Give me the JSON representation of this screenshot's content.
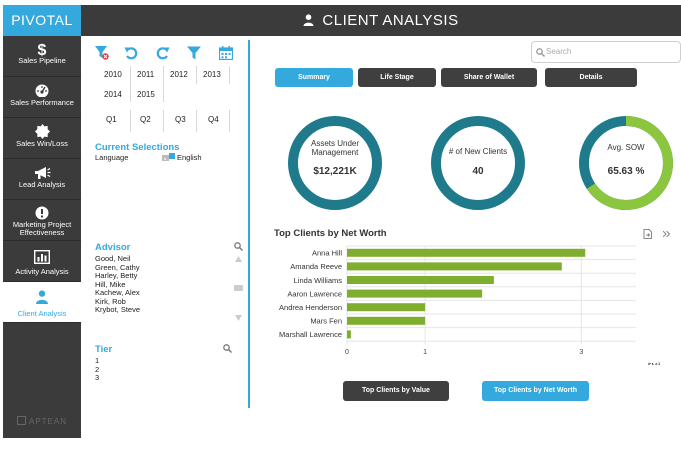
{
  "brand": "PIVOTAL",
  "header": {
    "title": "CLIENT ANALYSIS"
  },
  "sidebar": {
    "items": [
      {
        "label": "Sales Pipeline",
        "icon": "dollar-icon"
      },
      {
        "label": "Sales Performance",
        "icon": "gauge-icon"
      },
      {
        "label": "Sales Win/Loss",
        "icon": "badge-icon"
      },
      {
        "label": "Lead Analysis",
        "icon": "megaphone-icon"
      },
      {
        "label": "Marketing Project Effectiveness",
        "icon": "alert-icon"
      },
      {
        "label": "Activity Analysis",
        "icon": "bar-chart-icon"
      },
      {
        "label": "Client Analysis",
        "icon": "user-icon"
      }
    ],
    "footer": "APTEAN"
  },
  "filters": {
    "years": [
      "2010",
      "2011",
      "2012",
      "2013",
      "2014",
      "2015"
    ],
    "quarters": [
      "Q1",
      "Q2",
      "Q3",
      "Q4"
    ],
    "current_selections": {
      "title": "Current Selections",
      "field": "Language",
      "value": "English"
    },
    "advisor": {
      "title": "Advisor",
      "names": [
        "Good, Neil",
        "Green, Cathy",
        "Harley, Betty",
        "Hill, Mike",
        "Kachew, Alex",
        "Kirk, Rob",
        "Krybot, Steve"
      ]
    },
    "tier": {
      "title": "Tier",
      "values": [
        "1",
        "2",
        "3"
      ]
    }
  },
  "search": {
    "placeholder": "Search"
  },
  "tabs": [
    "Summary",
    "Life Stage",
    "Share of Wallet",
    "Details"
  ],
  "gauges": [
    {
      "label_line1": "Assets Under",
      "label_line2": "Management",
      "value": "$12,221K",
      "fraction": 1.0
    },
    {
      "label_line1": "# of New Clients",
      "label_line2": "",
      "value": "40",
      "fraction": 1.0
    },
    {
      "label_line1": "Avg. SOW",
      "label_line2": "",
      "value": "65.63 %",
      "fraction": 0.6563
    }
  ],
  "chart_data": {
    "type": "bar",
    "orientation": "horizontal",
    "title": "Top Clients by Net Worth",
    "categories": [
      "Anna Hill",
      "Amanda Reeve",
      "Linda Williams",
      "Aaron Lawrence",
      "Andrea Henderson",
      "Mars Fen",
      "Marshall Lawrence"
    ],
    "values": [
      3.05,
      2.75,
      1.88,
      1.73,
      1.0,
      1.0,
      0.05
    ],
    "xticks": [
      "0",
      "1",
      "3"
    ],
    "xtick_values": [
      0,
      1,
      3
    ],
    "xlim": [
      0,
      3.7
    ],
    "unit_label": "$Mil.",
    "grid": true,
    "bar_color": "#7fae2f"
  },
  "bottom_buttons": [
    "Top Clients by Value",
    "Top Clients by Net Worth"
  ],
  "colors": {
    "accent": "#34a9dd",
    "dark": "#3b3b3b",
    "teal": "#1f7b8c",
    "green": "#8cc63f"
  }
}
